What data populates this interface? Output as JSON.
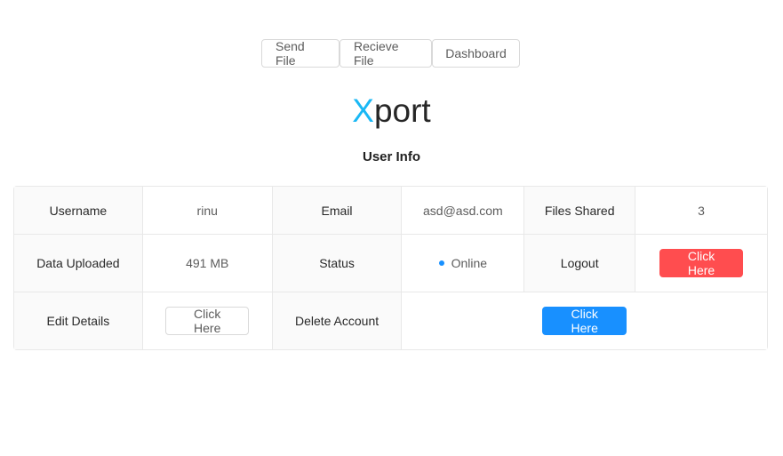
{
  "nav": {
    "send_file": "Send File",
    "receive_file": "Recieve File",
    "dashboard": "Dashboard"
  },
  "logo": {
    "accent": "X",
    "rest": "port",
    "accent_color": "#1ab8f5"
  },
  "subtitle": "User Info",
  "info": {
    "username_label": "Username",
    "username_value": "rinu",
    "email_label": "Email",
    "email_value": "asd@asd.com",
    "files_shared_label": "Files Shared",
    "files_shared_value": "3",
    "data_uploaded_label": "Data Uploaded",
    "data_uploaded_value": "491 MB",
    "status_label": "Status",
    "status_value": "Online",
    "logout_label": "Logout",
    "logout_button": "Click Here",
    "edit_details_label": "Edit Details",
    "edit_details_button": "Click Here",
    "delete_account_label": "Delete Account",
    "delete_account_button": "Click Here"
  },
  "colors": {
    "danger": "#ff4d4f",
    "primary": "#1890ff",
    "status_dot": "#1890ff"
  }
}
